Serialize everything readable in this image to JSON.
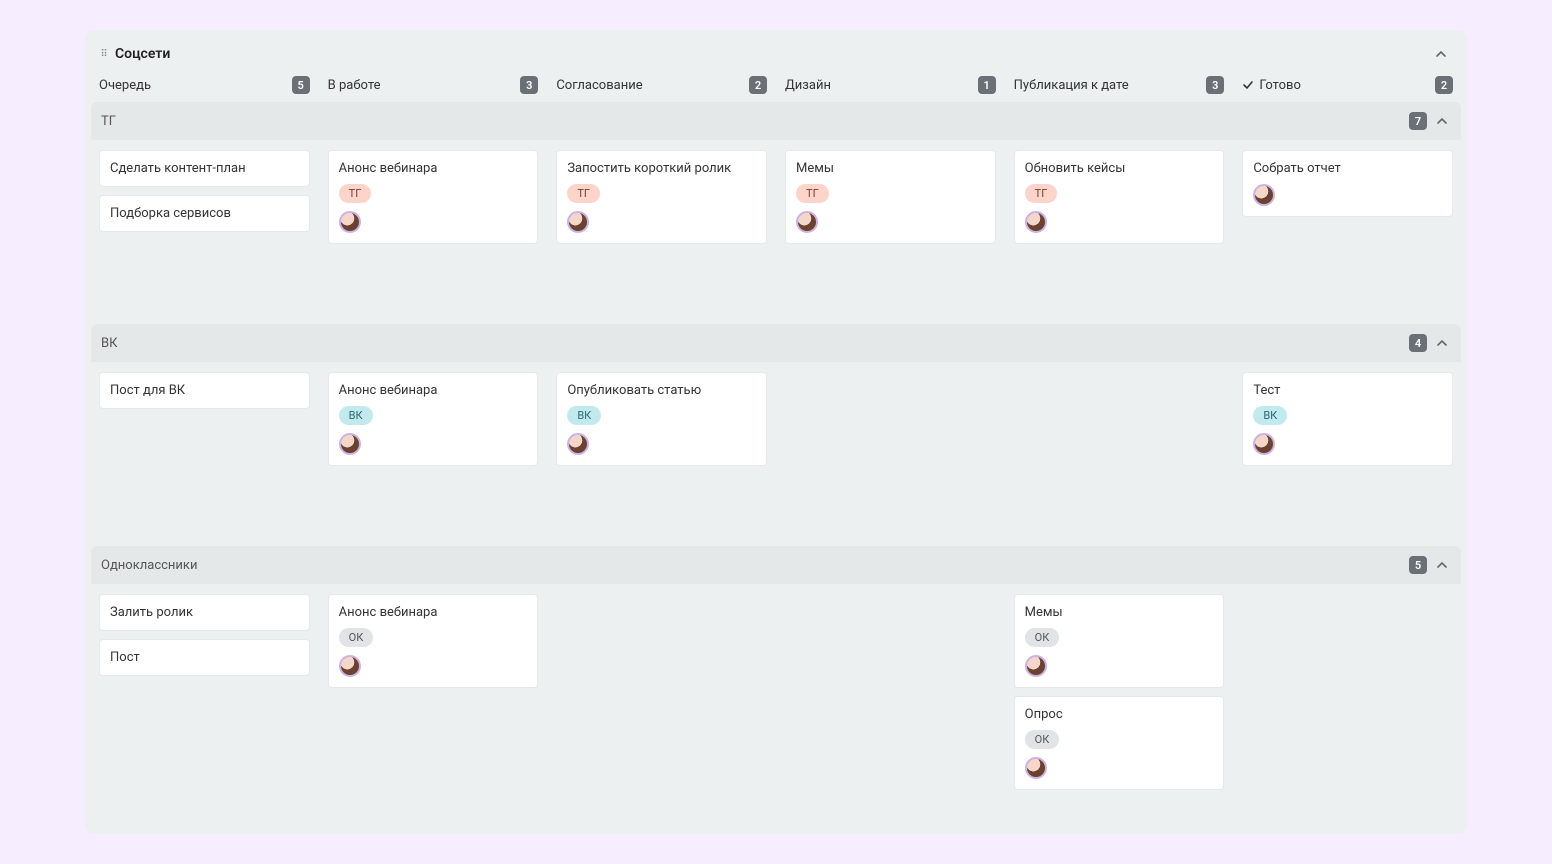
{
  "board": {
    "title": "Соцсети",
    "columns": [
      {
        "label": "Очередь",
        "count": "5",
        "done": false
      },
      {
        "label": "В работе",
        "count": "3",
        "done": false
      },
      {
        "label": "Согласование",
        "count": "2",
        "done": false
      },
      {
        "label": "Дизайн",
        "count": "1",
        "done": false
      },
      {
        "label": "Публикация к дате",
        "count": "3",
        "done": false
      },
      {
        "label": "Готово",
        "count": "2",
        "done": true
      }
    ],
    "swimlanes": [
      {
        "title": "ТГ",
        "count": "7",
        "tag_class": "tag-tg",
        "cells": [
          [
            {
              "title": "Сделать контент-план",
              "tag": null,
              "avatar": false
            },
            {
              "title": "Подборка сервисов",
              "tag": null,
              "avatar": false
            }
          ],
          [
            {
              "title": "Анонс вебинара",
              "tag": "ТГ",
              "avatar": true
            }
          ],
          [
            {
              "title": "Запостить короткий ролик",
              "tag": "ТГ",
              "avatar": true
            }
          ],
          [
            {
              "title": "Мемы",
              "tag": "ТГ",
              "avatar": true
            }
          ],
          [
            {
              "title": "Обновить кейсы",
              "tag": "ТГ",
              "avatar": true
            }
          ],
          [
            {
              "title": "Собрать отчет",
              "tag": null,
              "avatar": true
            }
          ]
        ]
      },
      {
        "title": "ВК",
        "count": "4",
        "tag_class": "tag-vk",
        "cells": [
          [
            {
              "title": "Пост для ВК",
              "tag": null,
              "avatar": false
            }
          ],
          [
            {
              "title": "Анонс вебинара",
              "tag": "ВК",
              "avatar": true
            }
          ],
          [
            {
              "title": "Опубликовать статью",
              "tag": "ВК",
              "avatar": true
            }
          ],
          [],
          [],
          [
            {
              "title": "Тест",
              "tag": "ВК",
              "avatar": true
            }
          ]
        ]
      },
      {
        "title": "Одноклассники",
        "count": "5",
        "tag_class": "tag-ok",
        "cells": [
          [
            {
              "title": "Залить ролик",
              "tag": null,
              "avatar": false
            },
            {
              "title": "Пост",
              "tag": null,
              "avatar": false
            }
          ],
          [
            {
              "title": "Анонс вебинара",
              "tag": "ОК",
              "avatar": true
            }
          ],
          [],
          [],
          [
            {
              "title": "Мемы",
              "tag": "ОК",
              "avatar": true
            },
            {
              "title": "Опрос",
              "tag": "ОК",
              "avatar": true
            }
          ],
          []
        ]
      }
    ]
  }
}
